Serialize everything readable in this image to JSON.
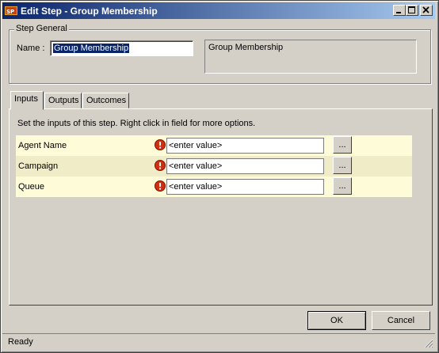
{
  "window": {
    "title": "Edit Step - Group Membership"
  },
  "titlebar_buttons": {
    "minimize_icon": "minimize-icon",
    "maximize_icon": "maximize-icon",
    "close_icon": "close-icon"
  },
  "step_general": {
    "legend": "Step General",
    "name_label": "Name :",
    "name_value": "Group Membership",
    "description": "Group Membership"
  },
  "tabs": [
    {
      "label": "Inputs",
      "active": true
    },
    {
      "label": "Outputs",
      "active": false
    },
    {
      "label": "Outcomes",
      "active": false
    }
  ],
  "inputs_panel": {
    "description": "Set the inputs of this step.  Right click in field for more options.",
    "rows": [
      {
        "label": "Agent Name",
        "value": "<enter value>",
        "button": "...",
        "icon": "warning-icon"
      },
      {
        "label": "Campaign",
        "value": "<enter value>",
        "button": "...",
        "icon": "warning-icon"
      },
      {
        "label": "Queue",
        "value": "<enter value>",
        "button": "...",
        "icon": "warning-icon"
      }
    ]
  },
  "footer": {
    "ok_label": "OK",
    "cancel_label": "Cancel"
  },
  "status": {
    "text": "Ready"
  },
  "colors": {
    "titlebar_start": "#0a246a",
    "titlebar_end": "#a6caf0",
    "row_bg": "#fefbd9",
    "row_alt_bg": "#f0ecc8",
    "warning": "#d03010"
  }
}
